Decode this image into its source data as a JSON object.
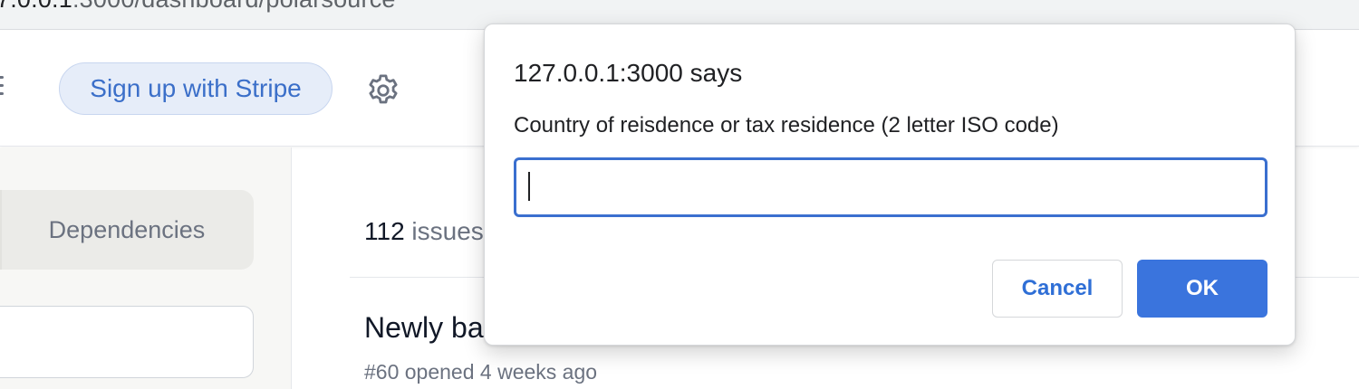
{
  "browser": {
    "url_host": "7.0.0.1",
    "url_path": ":3000/dashboard/polarsource"
  },
  "header": {
    "stripe_button_label": "Sign up with Stripe",
    "settings_icon": "gear-icon",
    "menu_icon": "menu-icon"
  },
  "sidebar": {
    "tab_label": "Dependencies"
  },
  "main": {
    "issues_count": "112",
    "issues_word": "issues",
    "issue": {
      "title": "Newly ba",
      "meta": "#60 opened 4 weeks ago"
    }
  },
  "dialog": {
    "title": "127.0.0.1:3000 says",
    "message": "Country of reisdence or tax residence (2 letter ISO code)",
    "input_value": "",
    "cancel_label": "Cancel",
    "ok_label": "OK"
  },
  "colors": {
    "accent": "#3a74dd",
    "stripe_button_bg": "#e6edf9",
    "stripe_button_text": "#3b6fc9"
  }
}
